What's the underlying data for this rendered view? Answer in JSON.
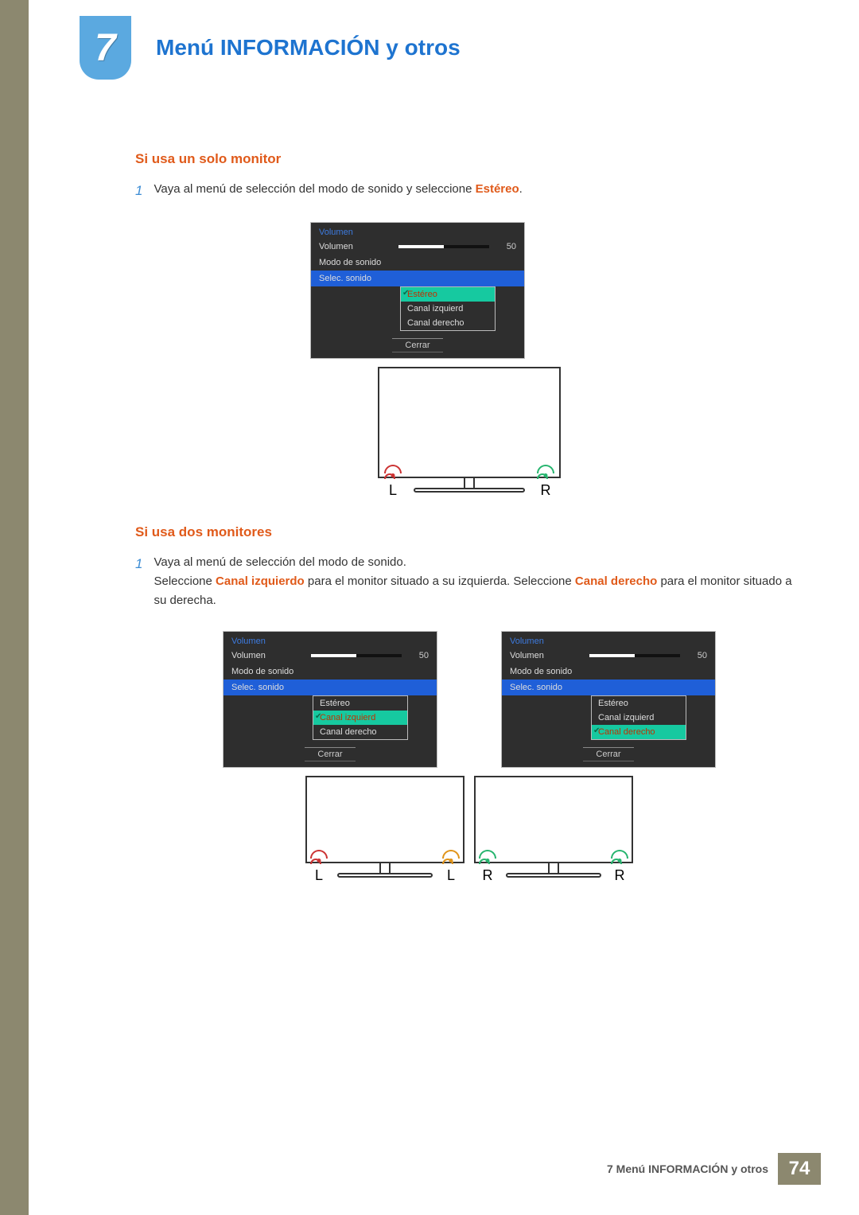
{
  "chapter": {
    "number": "7",
    "title": "Menú INFORMACIÓN y otros"
  },
  "s1": {
    "heading": "Si usa un solo monitor",
    "step_num": "1",
    "step_a": "Vaya al menú de selección del modo de sonido y seleccione ",
    "step_hl": "Estéreo",
    "step_b": "."
  },
  "s2": {
    "heading": "Si usa dos monitores",
    "step_num": "1",
    "line1": "Vaya al menú de selección del modo de sonido.",
    "line2a": "Seleccione ",
    "line2hl1": "Canal izquierdo",
    "line2b": " para el monitor situado a su izquierda. Seleccione ",
    "line2hl2": "Canal derecho",
    "line2c": " para el monitor situado a su derecha."
  },
  "osd": {
    "title": "Volumen",
    "row_vol": "Volumen",
    "vol_value": "50",
    "row_mode": "Modo de sonido",
    "row_select": "Selec. sonido",
    "opt_stereo": "Estéreo",
    "opt_left": "Canal izquierd",
    "opt_right": "Canal derecho",
    "close": "Cerrar"
  },
  "labels": {
    "L": "L",
    "R": "R"
  },
  "footer": {
    "text": "7 Menú INFORMACIÓN y otros",
    "page": "74"
  }
}
